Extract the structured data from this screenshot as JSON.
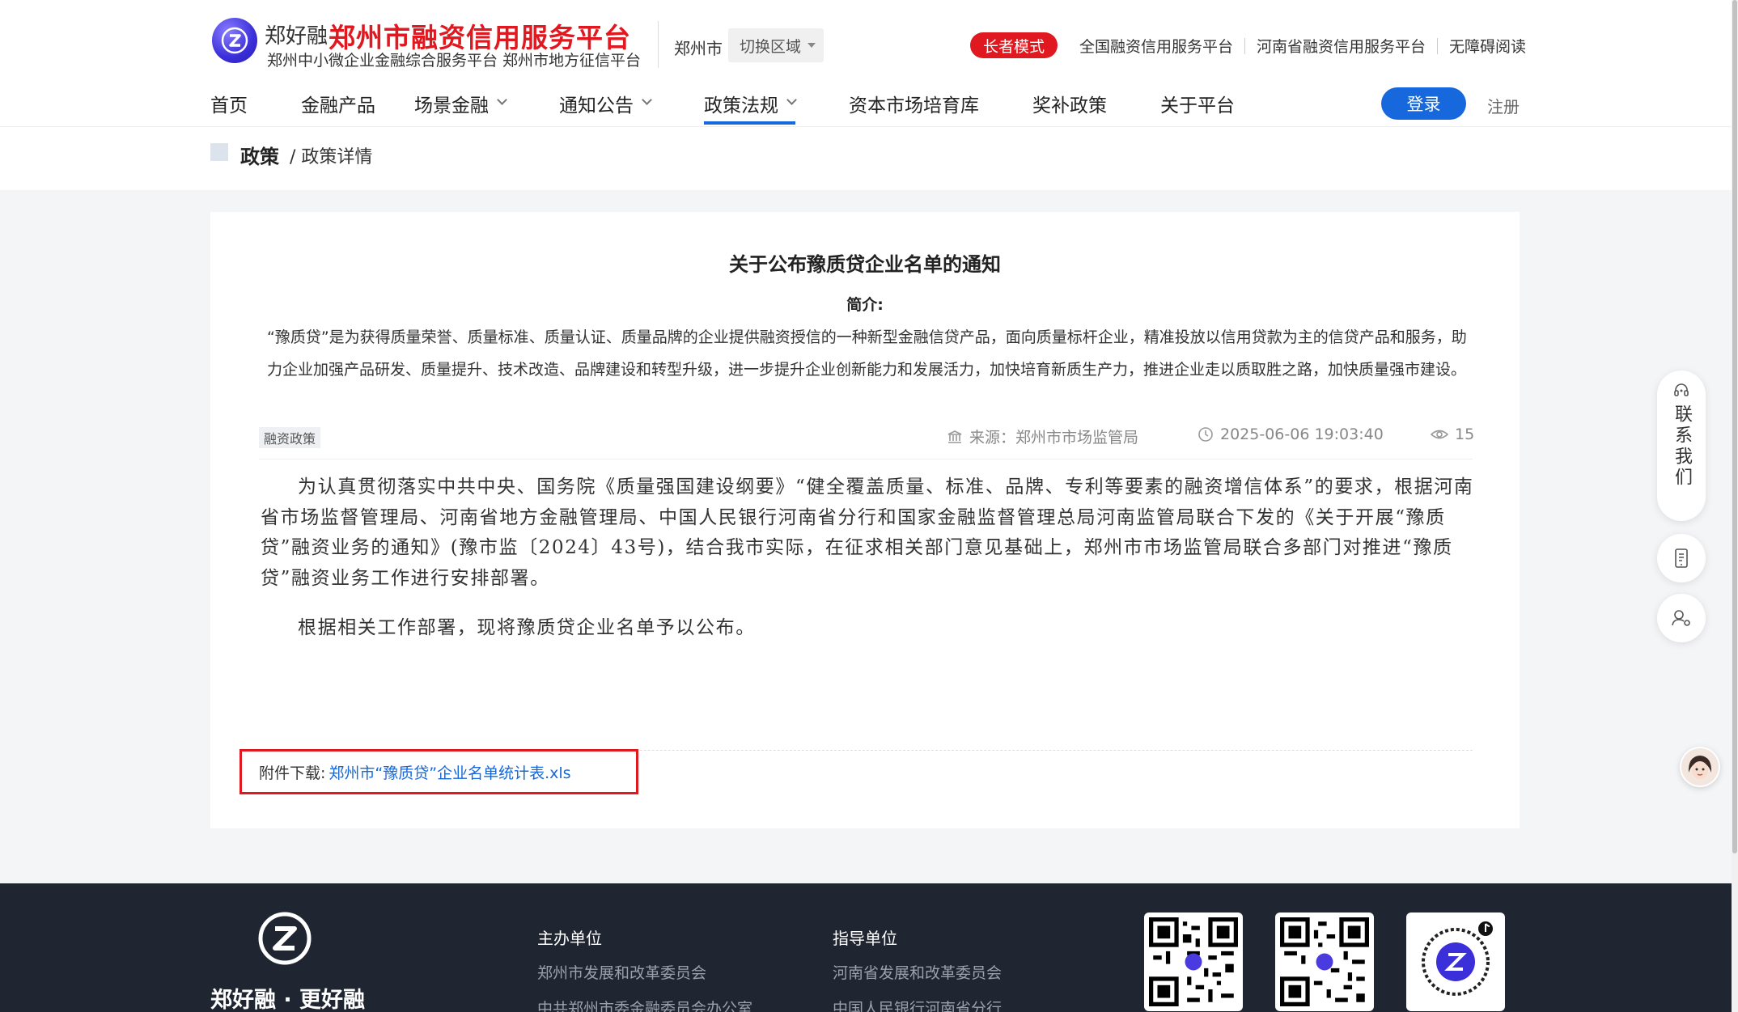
{
  "header": {
    "brand_small": "郑好融",
    "brand_big": "郑州市融资信用服务平台",
    "brand_sub": "郑州中小微企业金融综合服务平台 郑州市地方征信平台",
    "city": "郑州市",
    "region_button": "切换区域",
    "elder_mode": "长者模式",
    "top_links": [
      "全国融资信用服务平台",
      "河南省融资信用服务平台",
      "无障碍阅读"
    ],
    "nav": [
      {
        "label": "首页",
        "dropdown": false,
        "active": false
      },
      {
        "label": "金融产品",
        "dropdown": false,
        "active": false
      },
      {
        "label": "场景金融",
        "dropdown": true,
        "active": false
      },
      {
        "label": "通知公告",
        "dropdown": true,
        "active": false
      },
      {
        "label": "政策法规",
        "dropdown": true,
        "active": true
      },
      {
        "label": "资本市场培育库",
        "dropdown": false,
        "active": false
      },
      {
        "label": "奖补政策",
        "dropdown": false,
        "active": false
      },
      {
        "label": "关于平台",
        "dropdown": false,
        "active": false
      }
    ],
    "login": "登录",
    "register": "注册"
  },
  "breadcrumb": {
    "main": "政策",
    "sub": "/ 政策详情"
  },
  "article": {
    "title": "关于公布豫质贷企业名单的通知",
    "intro_label": "简介:",
    "intro_text": "“豫质贷”是为获得质量荣誉、质量标准、质量认证、质量品牌的企业提供融资授信的一种新型金融信贷产品，面向质量标杆企业，精准投放以信用贷款为主的信贷产品和服务，助力企业加强产品研发、质量提升、技术改造、品牌建设和转型升级，进一步提升企业创新能力和发展活力，加快培育新质生产力，推进企业走以质取胜之路，加快质量强市建设。",
    "tag": "融资政策",
    "source": "来源：郑州市市场监管局",
    "time": "2025-06-06 19:03:40",
    "views": "15",
    "paragraphs": [
      "为认真贯彻落实中共中央、国务院《质量强国建设纲要》“健全覆盖质量、标准、品牌、专利等要素的融资增信体系”的要求，根据河南省市场监督管理局、河南省地方金融管理局、中国人民银行河南省分行和国家金融监督管理总局河南监管局联合下发的《关于开展“豫质贷”融资业务的通知》(豫市监〔2024〕43号)，结合我市实际，在征求相关部门意见基础上，郑州市市场监管局联合多部门对推进“豫质贷”融资业务工作进行安排部署。",
      "根据相关工作部署，现将豫质贷企业名单予以公布。"
    ],
    "attachment_label": "附件下载:",
    "attachment_file": "郑州市“豫质贷”企业名单统计表.xls"
  },
  "sidebar": {
    "contact": "联系我们"
  },
  "footer": {
    "slogan": "郑好融 · 更好融",
    "host_title": "主办单位",
    "host_items": [
      "郑州市发展和改革委员会",
      "中共郑州市委金融委员会办公室"
    ],
    "guide_title": "指导单位",
    "guide_items": [
      "河南省发展和改革委员会",
      "中国人民银行河南省分行"
    ]
  },
  "colors": {
    "brand_red": "#e0181f",
    "primary_blue": "#1668dc",
    "footer_bg": "#1f2531"
  }
}
